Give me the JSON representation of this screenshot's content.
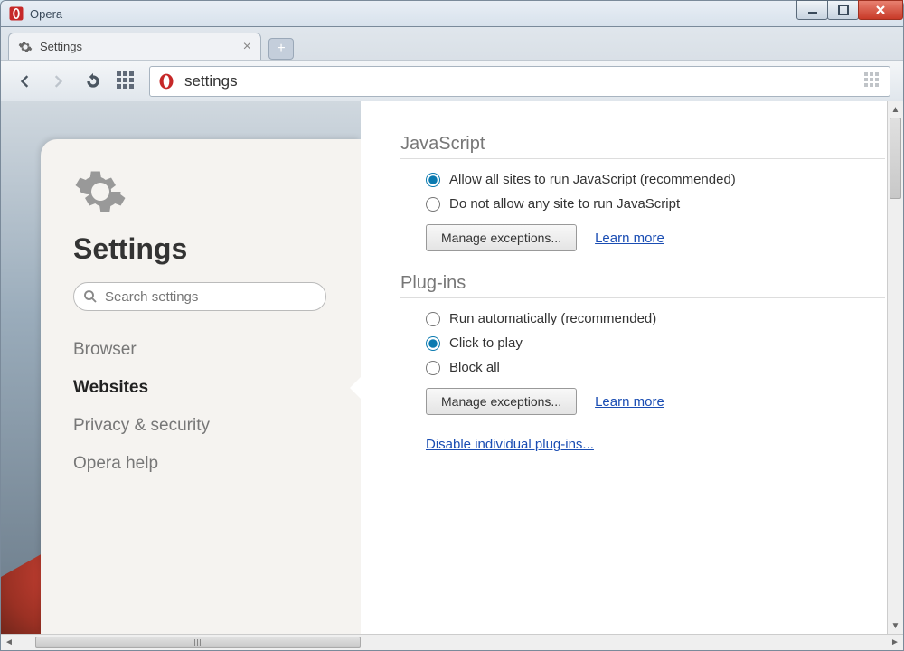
{
  "window": {
    "title": "Opera"
  },
  "tab": {
    "label": "Settings"
  },
  "addressbar": {
    "value": "settings"
  },
  "sidebar": {
    "title": "Settings",
    "search_placeholder": "Search settings",
    "items": [
      {
        "label": "Browser",
        "active": false
      },
      {
        "label": "Websites",
        "active": true
      },
      {
        "label": "Privacy & security",
        "active": false
      },
      {
        "label": "Opera help",
        "active": false
      }
    ]
  },
  "javascript": {
    "title": "JavaScript",
    "options": [
      {
        "label": "Allow all sites to run JavaScript (recommended)",
        "checked": true
      },
      {
        "label": "Do not allow any site to run JavaScript",
        "checked": false
      }
    ],
    "manage": "Manage exceptions...",
    "learn": "Learn more"
  },
  "plugins": {
    "title": "Plug-ins",
    "options": [
      {
        "label": "Run automatically (recommended)",
        "checked": false
      },
      {
        "label": "Click to play",
        "checked": true
      },
      {
        "label": "Block all",
        "checked": false
      }
    ],
    "manage": "Manage exceptions...",
    "learn": "Learn more",
    "disable": "Disable individual plug-ins..."
  }
}
